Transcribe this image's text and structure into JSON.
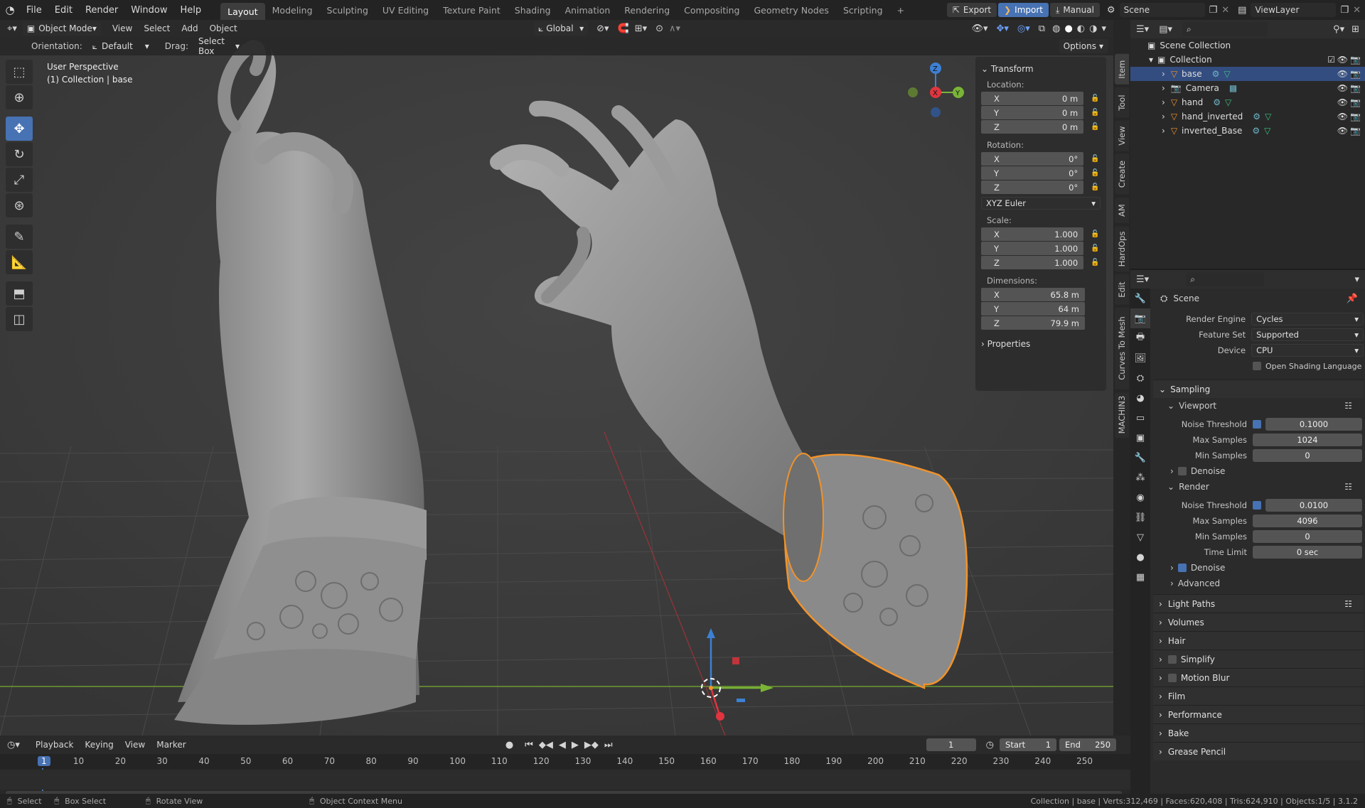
{
  "topbar": {
    "menus": [
      "File",
      "Edit",
      "Render",
      "Window",
      "Help"
    ],
    "workspaces": [
      "Layout",
      "Modeling",
      "Sculpting",
      "UV Editing",
      "Texture Paint",
      "Shading",
      "Animation",
      "Rendering",
      "Compositing",
      "Geometry Nodes",
      "Scripting"
    ],
    "add_tab": "+",
    "export_label": "Export",
    "import_label": "Import",
    "manual_label": "Manual",
    "scene_name": "Scene",
    "view_layer": "ViewLayer"
  },
  "viewport_header": {
    "mode": "Object Mode",
    "menus": [
      "View",
      "Select",
      "Add",
      "Object"
    ],
    "transform_orientation": "Global"
  },
  "tool_header": {
    "orientation_label": "Orientation:",
    "orientation_value": "Default",
    "drag_label": "Drag:",
    "drag_value": "Select Box",
    "options_label": "Options"
  },
  "viewport": {
    "perspective": "User Perspective",
    "context": "(1) Collection | base",
    "gizmo_labels": {
      "x": "X",
      "y": "Y",
      "z": "Z"
    }
  },
  "npanel": {
    "transform_title": "Transform",
    "location_label": "Location:",
    "location": [
      {
        "axis": "X",
        "value": "0 m"
      },
      {
        "axis": "Y",
        "value": "0 m"
      },
      {
        "axis": "Z",
        "value": "0 m"
      }
    ],
    "rotation_label": "Rotation:",
    "rotation": [
      {
        "axis": "X",
        "value": "0°"
      },
      {
        "axis": "Y",
        "value": "0°"
      },
      {
        "axis": "Z",
        "value": "0°"
      }
    ],
    "rotation_mode": "XYZ Euler",
    "scale_label": "Scale:",
    "scale": [
      {
        "axis": "X",
        "value": "1.000"
      },
      {
        "axis": "Y",
        "value": "1.000"
      },
      {
        "axis": "Z",
        "value": "1.000"
      }
    ],
    "dimensions_label": "Dimensions:",
    "dimensions": [
      {
        "axis": "X",
        "value": "65.8 m"
      },
      {
        "axis": "Y",
        "value": "64 m"
      },
      {
        "axis": "Z",
        "value": "79.9 m"
      }
    ],
    "properties_label": "Properties",
    "tabs": [
      "Item",
      "Tool",
      "View",
      "Create",
      "AM",
      "HardOps",
      "Edit",
      "Curves To Mesh",
      "MACHIN3"
    ]
  },
  "outliner": {
    "root": "Scene Collection",
    "collection": "Collection",
    "items": [
      {
        "name": "base",
        "selected": true
      },
      {
        "name": "Camera",
        "selected": false
      },
      {
        "name": "hand",
        "selected": false
      },
      {
        "name": "hand_inverted",
        "selected": false
      },
      {
        "name": "inverted_Base",
        "selected": false
      }
    ]
  },
  "properties": {
    "context": "Scene",
    "render_engine_label": "Render Engine",
    "render_engine": "Cycles",
    "feature_set_label": "Feature Set",
    "feature_set": "Supported",
    "device_label": "Device",
    "device": "CPU",
    "osl_label": "Open Shading Language",
    "sampling": "Sampling",
    "viewport": "Viewport",
    "noise_threshold_label": "Noise Threshold",
    "vp_noise_threshold": "0.1000",
    "max_samples_label": "Max Samples",
    "vp_max_samples": "1024",
    "min_samples_label": "Min Samples",
    "vp_min_samples": "0",
    "denoise_label": "Denoise",
    "render": "Render",
    "r_noise_threshold": "0.0100",
    "r_max_samples": "4096",
    "r_min_samples": "0",
    "time_limit_label": "Time Limit",
    "r_time_limit": "0 sec",
    "advanced": "Advanced",
    "sections": [
      "Light Paths",
      "Volumes",
      "Hair",
      "Simplify",
      "Motion Blur",
      "Film",
      "Performance",
      "Bake",
      "Grease Pencil"
    ]
  },
  "timeline": {
    "menus": [
      "Playback",
      "Keying",
      "View",
      "Marker"
    ],
    "current_frame": "1",
    "start_label": "Start",
    "start": "1",
    "end_label": "End",
    "end": "250",
    "ruler": [
      "1",
      "10",
      "20",
      "30",
      "40",
      "50",
      "60",
      "70",
      "80",
      "90",
      "100",
      "110",
      "120",
      "130",
      "140",
      "150",
      "160",
      "170",
      "180",
      "190",
      "200",
      "210",
      "220",
      "230",
      "240",
      "250"
    ]
  },
  "statusbar": {
    "select": "Select",
    "box_select": "Box Select",
    "rotate_view": "Rotate View",
    "context_menu": "Object Context Menu",
    "stats": "Collection | base | Verts:312,469 | Faces:620,408 | Tris:624,910 | Objects:1/5 | 3.1.2"
  },
  "colors": {
    "accent": "#4772b3",
    "selection": "#f0932b",
    "x_axis": "#e0353f",
    "y_axis": "#7ab437",
    "z_axis": "#3d80d4"
  }
}
